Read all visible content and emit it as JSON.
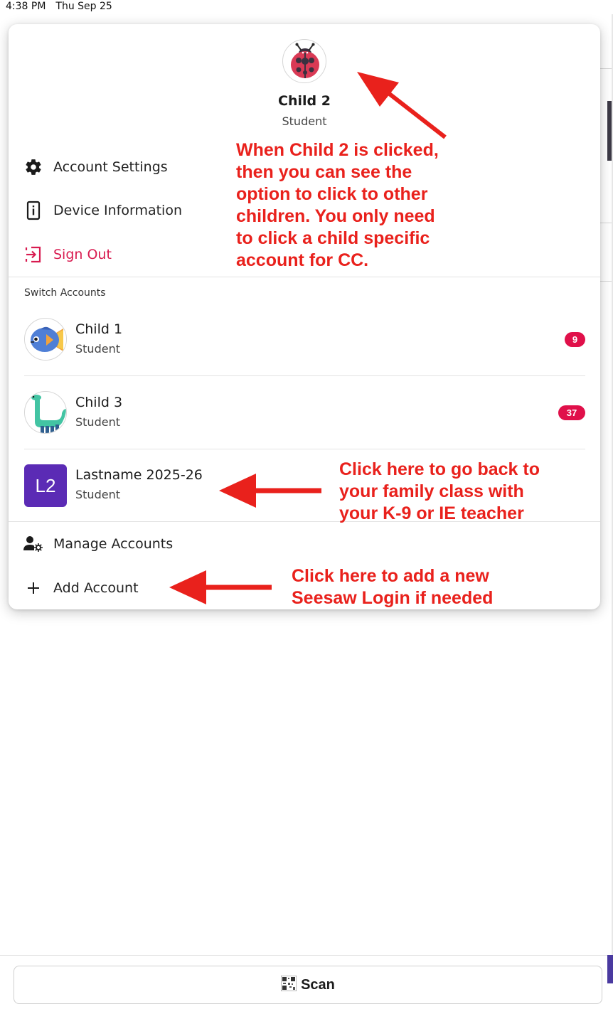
{
  "status_bar": {
    "time": "4:38 PM",
    "date": "Thu Sep 25"
  },
  "profile": {
    "name": "Child 2",
    "role": "Student",
    "avatar_icon": "ladybug-icon"
  },
  "menu": {
    "account_settings": "Account Settings",
    "device_information": "Device Information",
    "sign_out": "Sign Out"
  },
  "switch_accounts": {
    "title": "Switch Accounts",
    "accounts": [
      {
        "name": "Child 1",
        "role": "Student",
        "badge": "9",
        "avatar_icon": "fish-icon"
      },
      {
        "name": "Child 3",
        "role": "Student",
        "badge": "37",
        "avatar_icon": "dinosaur-icon"
      },
      {
        "name": "Lastname 2025-26",
        "role": "Student",
        "initials": "L2",
        "avatar_color": "#5b2bb5"
      }
    ]
  },
  "footer_menu": {
    "manage_accounts": "Manage Accounts",
    "add_account": "Add Account"
  },
  "annotations": {
    "child2_note": "When Child 2 is clicked,\nthen you can see the\noption to click to other\nchildren. You only need\nto click a child specific\naccount for CC.",
    "family_class_note": "Click here to go back to\nyour family class with\nyour K-9 or IE teacher",
    "add_login_note": "Click here to add a new\nSeesaw Login if needed"
  },
  "bottom": {
    "scan_label": "Scan",
    "scan_icon": "qr-code-icon"
  },
  "colors": {
    "accent_red": "#e0104a",
    "annotation_red": "#e9211c",
    "class_purple": "#5b2bb5",
    "sign_out": "#d81b50"
  }
}
